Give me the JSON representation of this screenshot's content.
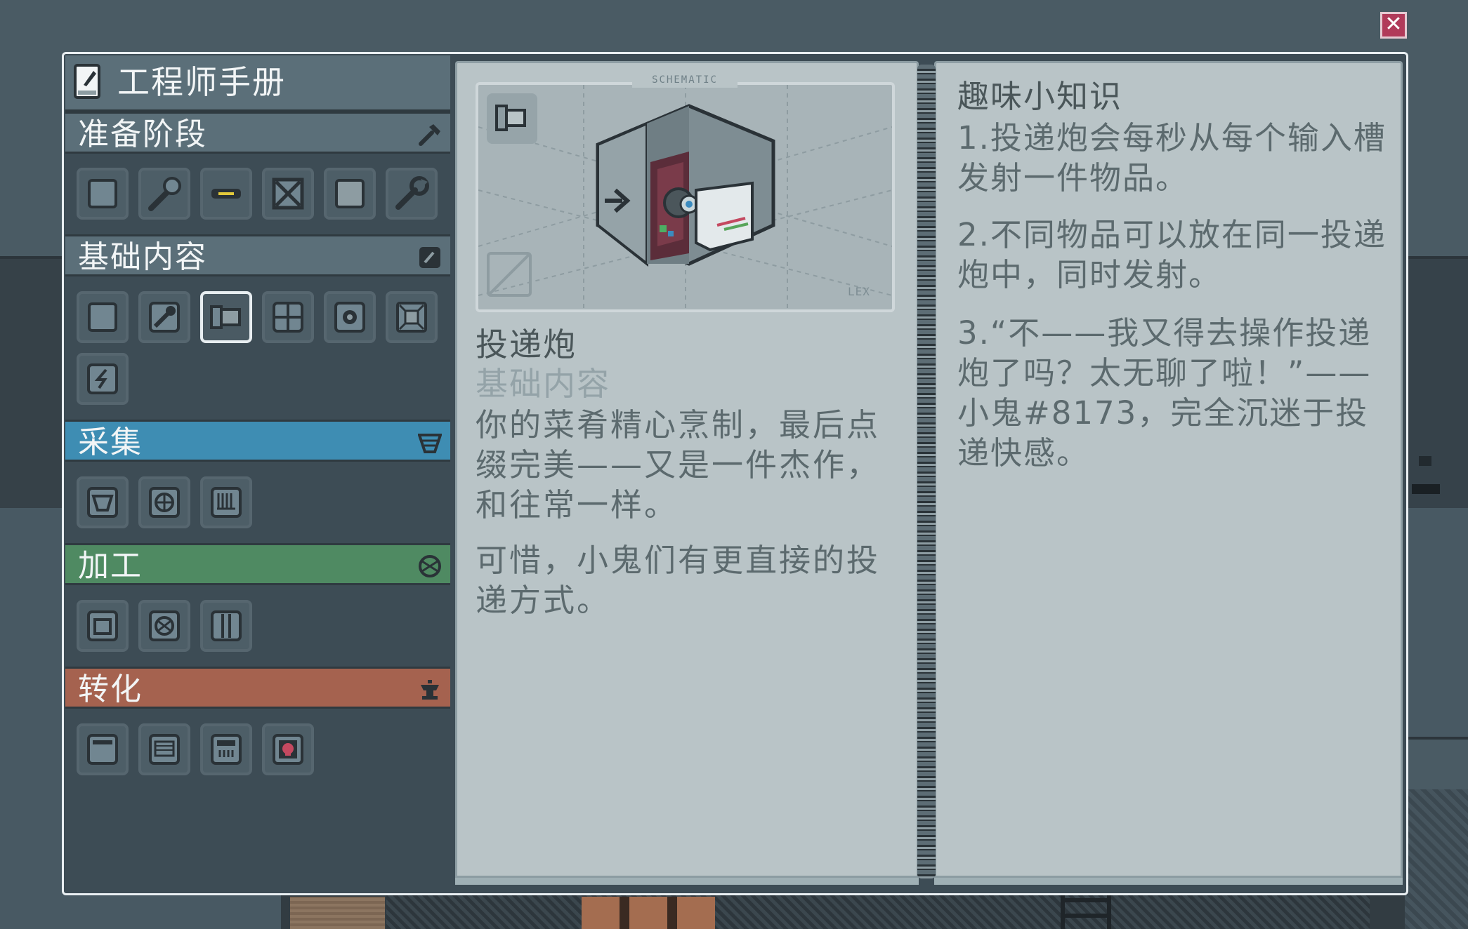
{
  "window": {
    "close_icon": "close-icon",
    "close_glyph": "✕"
  },
  "sidebar": {
    "title": "工程师手册",
    "title_icon": "notebook-icon",
    "sections": [
      {
        "label": "准备阶段",
        "icon": "hammer-icon",
        "color": "#5b6f79",
        "items": [
          "spawner-icon",
          "hammer-icon",
          "belt-icon",
          "crate-icon",
          "block-icon",
          "wrench-icon"
        ]
      },
      {
        "label": "基础内容",
        "icon": "pen-icon",
        "color": "#5b6f79",
        "items": [
          "pen-icon",
          "hammer-icon",
          "cannon-icon",
          "grid-icon",
          "gear-icon",
          "frame-icon",
          "bolt-icon"
        ]
      },
      {
        "label": "采集",
        "icon": "funnel-icon",
        "color": "#3e8db3",
        "items": [
          "funnel-icon",
          "fan-icon",
          "comb-icon"
        ]
      },
      {
        "label": "加工",
        "icon": "sphere-icon",
        "color": "#4f8a62",
        "items": [
          "pot-icon",
          "sphere-icon",
          "panel-icon"
        ]
      },
      {
        "label": "转化",
        "icon": "anvil-icon",
        "color": "#a5624f",
        "items": [
          "oven-icon",
          "mesh-icon",
          "furnace-icon",
          "skull-icon"
        ]
      }
    ]
  },
  "detail": {
    "schematic_label": "SCHEMATIC",
    "watermark": "LEX",
    "item_icon": "cannon-icon",
    "name": "投递炮",
    "category": "基础内容",
    "description": "你的菜肴精心烹制，最后点缀完美——又是一件杰作，和往常一样。",
    "description2": "可惜，小鬼们有更直接的投递方式。"
  },
  "trivia": {
    "title": "趣味小知识",
    "items": [
      "1.投递炮会每秒从每个输入槽发射一件物品。",
      "2.不同物品可以放在同一投递炮中，同时发射。",
      "3.“不——我又得去操作投递炮了吗？太无聊了啦！”——小鬼#8173，完全沉迷于投递快感。"
    ]
  }
}
